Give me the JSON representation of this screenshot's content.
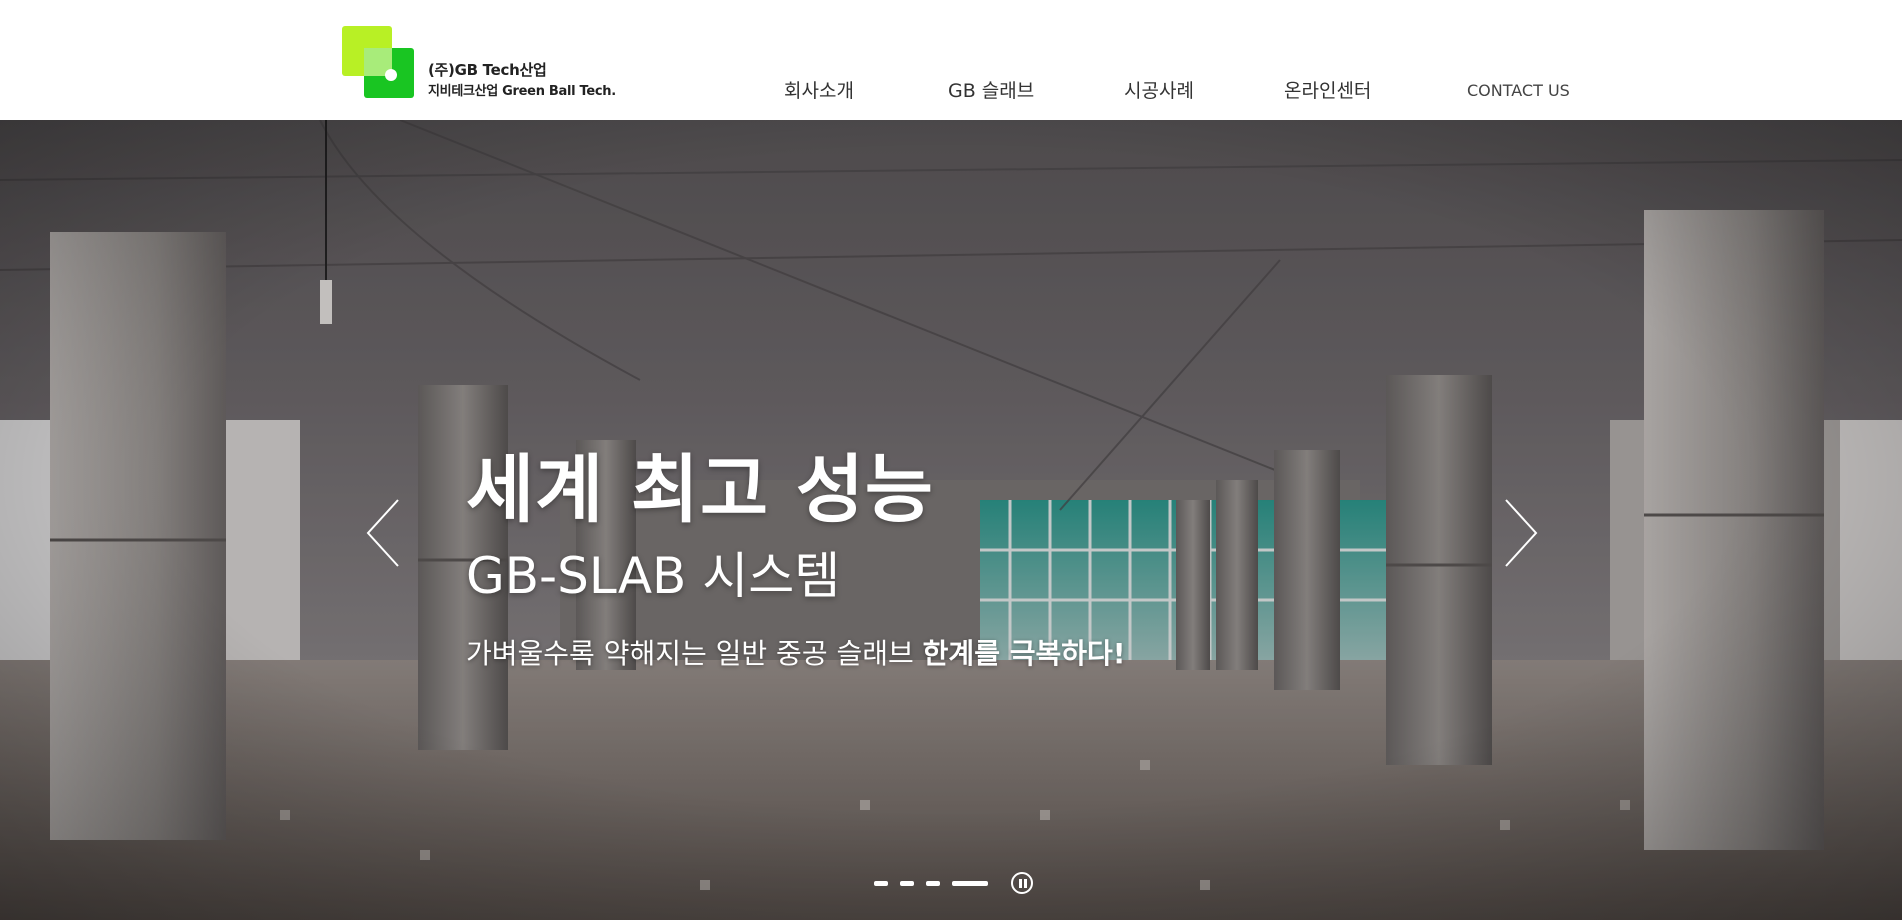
{
  "brand": {
    "name_line1": "(주)GB Tech산업",
    "name_line2": "지비테크산업 Green Ball Tech.",
    "colors": {
      "logo_light": "#b8f025",
      "logo_dark": "#19c522"
    }
  },
  "nav": {
    "items": [
      {
        "label": "회사소개"
      },
      {
        "label": "GB 슬래브"
      },
      {
        "label": "시공사례"
      },
      {
        "label": "온라인센터"
      },
      {
        "label": "CONTACT US"
      }
    ]
  },
  "hero": {
    "title": "세계 최고 성능",
    "subtitle": "GB-SLAB 시스템",
    "desc_normal": "가벼울수록 약해지는 일반 중공 슬래브 ",
    "desc_bold": "한계를 극복하다!",
    "prev_icon": "chevron-left-icon",
    "next_icon": "chevron-right-icon"
  },
  "slider": {
    "slide_count": 4,
    "active_index": 3,
    "pause_icon": "pause-icon"
  }
}
